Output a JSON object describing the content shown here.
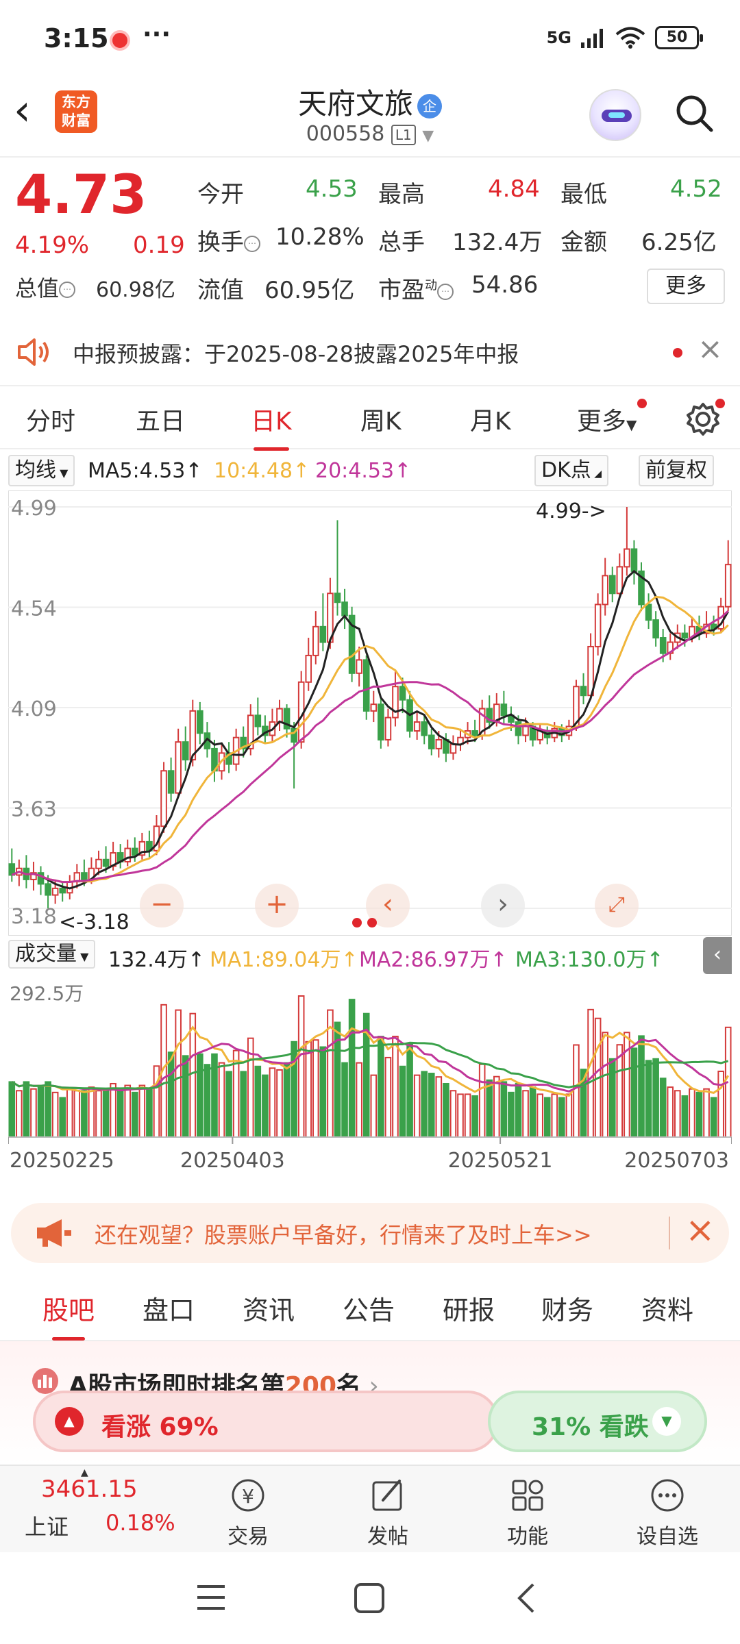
{
  "status": {
    "time": "3:15",
    "dots": "···",
    "network": "5G",
    "battery": "50"
  },
  "header": {
    "logo_line1": "东方",
    "logo_line2": "财富",
    "stock_name": "天府文旅",
    "badge": "企",
    "stock_code": "000558",
    "level": "L1",
    "back_icon": "back-chevron-icon",
    "search_icon": "search-icon"
  },
  "quote": {
    "price": "4.73",
    "change_pct": "4.19%",
    "change": "0.19",
    "open_label": "今开",
    "open": "4.53",
    "high_label": "最高",
    "high": "4.84",
    "low_label": "最低",
    "low": "4.52",
    "turnover_label": "换手",
    "turnover": "10.28%",
    "volume_label": "总手",
    "volume": "132.4万",
    "amount_label": "金额",
    "amount": "6.25亿",
    "mktcap_label": "总值",
    "mktcap": "60.98亿",
    "float_label": "流值",
    "float_cap": "60.95亿",
    "pe_label": "市盈",
    "pe_super": "动",
    "pe": "54.86",
    "more_label": "更多"
  },
  "notice": {
    "text": "中报预披露：于2025-08-28披露2025年中报"
  },
  "period_tabs": [
    "分时",
    "五日",
    "日K",
    "周K",
    "月K",
    "更多"
  ],
  "period_active": "日K",
  "indicators": {
    "ma_selector": "均线",
    "ma5": "MA5:4.53",
    "ma10": "10:4.48",
    "ma20": "20:4.53",
    "dk_label": "DK点",
    "adjust_label": "前复权"
  },
  "volume_indicators": {
    "selector": "成交量",
    "vol": "132.4万",
    "ma1": "MA1:89.04万",
    "ma2": "MA2:86.97万",
    "ma3": "MA3:130.0万"
  },
  "chart_data": {
    "type": "candlestick",
    "price_axis_ticks": [
      "4.99",
      "4.54",
      "4.09",
      "3.63",
      "3.18"
    ],
    "ylim": [
      3.18,
      4.99
    ],
    "high_marker": "4.99->",
    "low_marker": "<-3.18",
    "volume_axis_max": "292.5万",
    "x_ticks": [
      "20250225",
      "20250403",
      "20250521",
      "20250703"
    ],
    "series": [
      {
        "name": "MA5",
        "color": "#222222"
      },
      {
        "name": "MA10",
        "color": "#f0b53a"
      },
      {
        "name": "MA20",
        "color": "#c0369a"
      }
    ],
    "candles": [
      [
        3.38,
        3.33,
        3.45,
        3.3
      ],
      [
        3.33,
        3.36,
        3.4,
        3.28
      ],
      [
        3.36,
        3.31,
        3.42,
        3.27
      ],
      [
        3.31,
        3.34,
        3.39,
        3.26
      ],
      [
        3.34,
        3.29,
        3.37,
        3.24
      ],
      [
        3.29,
        3.24,
        3.33,
        3.18
      ],
      [
        3.24,
        3.27,
        3.31,
        3.2
      ],
      [
        3.27,
        3.25,
        3.3,
        3.21
      ],
      [
        3.25,
        3.3,
        3.33,
        3.22
      ],
      [
        3.3,
        3.34,
        3.38,
        3.27
      ],
      [
        3.34,
        3.31,
        3.4,
        3.28
      ],
      [
        3.31,
        3.36,
        3.41,
        3.29
      ],
      [
        3.36,
        3.4,
        3.44,
        3.33
      ],
      [
        3.4,
        3.37,
        3.46,
        3.34
      ],
      [
        3.37,
        3.43,
        3.48,
        3.35
      ],
      [
        3.43,
        3.39,
        3.47,
        3.36
      ],
      [
        3.39,
        3.45,
        3.49,
        3.37
      ],
      [
        3.45,
        3.42,
        3.5,
        3.39
      ],
      [
        3.42,
        3.48,
        3.52,
        3.4
      ],
      [
        3.48,
        3.44,
        3.53,
        3.41
      ],
      [
        3.44,
        3.55,
        3.6,
        3.42
      ],
      [
        3.55,
        3.8,
        3.84,
        3.52
      ],
      [
        3.8,
        3.7,
        3.86,
        3.66
      ],
      [
        3.7,
        3.93,
        3.99,
        3.68
      ],
      [
        3.93,
        3.85,
        4.0,
        3.8
      ],
      [
        3.85,
        4.07,
        4.12,
        3.82
      ],
      [
        4.07,
        3.97,
        4.11,
        3.92
      ],
      [
        3.97,
        3.9,
        4.02,
        3.86
      ],
      [
        3.9,
        3.8,
        3.94,
        3.75
      ],
      [
        3.8,
        3.88,
        3.92,
        3.76
      ],
      [
        3.88,
        3.83,
        3.93,
        3.79
      ],
      [
        3.83,
        3.95,
        3.99,
        3.8
      ],
      [
        3.95,
        3.9,
        4.0,
        3.86
      ],
      [
        3.9,
        4.05,
        4.1,
        3.87
      ],
      [
        4.05,
        4.0,
        4.13,
        3.96
      ],
      [
        4.0,
        3.96,
        4.05,
        3.92
      ],
      [
        3.96,
        4.02,
        4.08,
        3.93
      ],
      [
        4.02,
        4.08,
        4.12,
        3.98
      ],
      [
        4.08,
        3.99,
        4.1,
        3.95
      ],
      [
        3.99,
        3.93,
        4.02,
        3.72
      ],
      [
        3.93,
        4.2,
        4.25,
        3.9
      ],
      [
        4.2,
        4.32,
        4.4,
        4.16
      ],
      [
        4.32,
        4.45,
        4.52,
        4.28
      ],
      [
        4.45,
        4.38,
        4.6,
        4.34
      ],
      [
        4.38,
        4.6,
        4.67,
        4.35
      ],
      [
        4.6,
        4.56,
        4.93,
        4.5
      ],
      [
        4.56,
        4.5,
        4.62,
        4.44
      ],
      [
        4.5,
        4.24,
        4.54,
        4.2
      ],
      [
        4.24,
        4.3,
        4.36,
        4.18
      ],
      [
        4.3,
        4.07,
        4.32,
        4.03
      ],
      [
        4.07,
        4.1,
        4.16,
        4.02
      ],
      [
        4.1,
        3.94,
        4.13,
        3.9
      ],
      [
        3.94,
        4.04,
        4.08,
        3.91
      ],
      [
        4.04,
        4.18,
        4.25,
        4.0
      ],
      [
        4.18,
        4.12,
        4.22,
        4.06
      ],
      [
        4.12,
        3.98,
        4.16,
        3.95
      ],
      [
        3.98,
        4.02,
        4.07,
        3.94
      ],
      [
        4.02,
        3.96,
        4.05,
        3.92
      ],
      [
        3.96,
        3.9,
        3.99,
        3.87
      ],
      [
        3.9,
        3.94,
        3.98,
        3.86
      ],
      [
        3.94,
        3.88,
        3.97,
        3.84
      ],
      [
        3.88,
        3.92,
        3.96,
        3.85
      ],
      [
        3.92,
        3.95,
        3.99,
        3.89
      ],
      [
        3.95,
        3.98,
        4.02,
        3.92
      ],
      [
        3.98,
        3.96,
        4.03,
        3.93
      ],
      [
        3.96,
        4.08,
        4.12,
        3.94
      ],
      [
        4.08,
        4.02,
        4.14,
        3.99
      ],
      [
        4.02,
        4.1,
        4.15,
        4.0
      ],
      [
        4.1,
        4.05,
        4.16,
        4.01
      ],
      [
        4.05,
        4.02,
        4.09,
        3.98
      ],
      [
        4.02,
        3.96,
        4.05,
        3.92
      ],
      [
        3.96,
        4.0,
        4.04,
        3.93
      ],
      [
        4.0,
        3.94,
        4.02,
        3.91
      ],
      [
        3.94,
        3.98,
        4.01,
        3.92
      ],
      [
        3.98,
        3.95,
        4.0,
        3.92
      ],
      [
        3.95,
        3.99,
        4.02,
        3.93
      ],
      [
        3.99,
        3.96,
        4.01,
        3.93
      ],
      [
        3.96,
        4.0,
        4.03,
        3.94
      ],
      [
        4.0,
        4.18,
        4.21,
        3.98
      ],
      [
        4.18,
        4.14,
        4.24,
        4.1
      ],
      [
        4.14,
        4.36,
        4.42,
        4.12
      ],
      [
        4.36,
        4.55,
        4.6,
        4.32
      ],
      [
        4.55,
        4.68,
        4.76,
        4.5
      ],
      [
        4.68,
        4.6,
        4.72,
        4.56
      ],
      [
        4.6,
        4.72,
        4.78,
        4.58
      ],
      [
        4.72,
        4.8,
        4.99,
        4.68
      ],
      [
        4.8,
        4.7,
        4.84,
        4.64
      ],
      [
        4.7,
        4.55,
        4.74,
        4.52
      ],
      [
        4.55,
        4.48,
        4.6,
        4.44
      ],
      [
        4.48,
        4.4,
        4.52,
        4.36
      ],
      [
        4.4,
        4.33,
        4.44,
        4.29
      ],
      [
        4.33,
        4.38,
        4.42,
        4.3
      ],
      [
        4.38,
        4.42,
        4.46,
        4.35
      ],
      [
        4.42,
        4.4,
        4.46,
        4.36
      ],
      [
        4.4,
        4.45,
        4.49,
        4.38
      ],
      [
        4.45,
        4.42,
        4.5,
        4.39
      ],
      [
        4.42,
        4.46,
        4.52,
        4.4
      ],
      [
        4.46,
        4.44,
        4.5,
        4.41
      ],
      [
        4.44,
        4.54,
        4.58,
        4.42
      ],
      [
        4.54,
        4.73,
        4.84,
        4.52
      ]
    ]
  },
  "promo": {
    "text": "还在观望？股票账户早备好，行情来了及时上车>>"
  },
  "content_tabs": [
    "股吧",
    "盘口",
    "资讯",
    "公告",
    "研报",
    "财务",
    "资料"
  ],
  "content_active": "股吧",
  "ranking": {
    "prefix": "A股市场即时排名第",
    "rank": "200",
    "suffix": "名",
    "bull": "看涨 69%",
    "bear": "31% 看跌"
  },
  "bottom_bar": {
    "index_value": "3461.15",
    "index_name": "上证",
    "index_change": "0.18%",
    "trade": "交易",
    "post": "发帖",
    "functions": "功能",
    "watchlist": "设自选"
  }
}
